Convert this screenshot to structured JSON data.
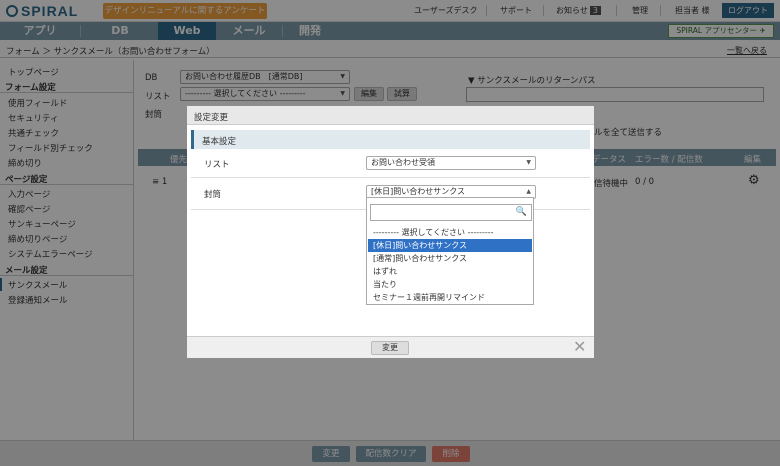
{
  "topbar": {
    "logo": "SPIRAL",
    "survey_button": "デザインリニューアルに関するアンケート",
    "links": [
      "ユーザーズデスク",
      "サポート",
      "お知らせ",
      "管理",
      "担当者 様"
    ],
    "notice_count": "3",
    "logout": "ログアウト"
  },
  "nav": {
    "tabs": [
      "アプリ",
      "DB",
      "Web",
      "メール",
      "開発"
    ],
    "active": "Web",
    "app_center": "SPIRAL アプリセンター"
  },
  "breadcrumb": "フォーム ＞ サンクスメール（お問い合わせフォーム）",
  "back_link": "一覧へ戻る",
  "sidebar": {
    "top": "トップページ",
    "form_heading": "フォーム設定",
    "form_items": [
      "使用フィールド",
      "セキュリティ",
      "共通チェック",
      "フィールド別チェック",
      "締め切り"
    ],
    "page_heading": "ページ設定",
    "page_items": [
      "入力ページ",
      "確認ページ",
      "サンキューページ",
      "締め切りページ",
      "システムエラーページ"
    ],
    "mail_heading": "メール設定",
    "mail_items": [
      "サンクスメール",
      "登録通知メール"
    ]
  },
  "main": {
    "db_label": "DB",
    "db_value": "お問い合わせ履歴DB　[通常DB]",
    "list_label": "リスト",
    "list_value": "--------- 選択してください ---------",
    "edit_btn": "編集",
    "test_btn": "試算",
    "envelope_label": "封筒",
    "return_path": "▼ サンクスメールのリターンパス",
    "send_all": "ルを全て送信する",
    "table_headers": [
      "優先",
      "データス",
      "エラー数 / 配信数",
      "編集"
    ],
    "row": {
      "index": "≡  1",
      "status": "信待機中",
      "count": "0 / 0"
    }
  },
  "bottom": {
    "change": "変更",
    "clear": "配信数クリア",
    "delete": "削除"
  },
  "modal": {
    "title": "設定変更",
    "section": "基本設定",
    "list_label": "リスト",
    "list_value": "お問い合わせ受領",
    "envelope_label": "封筒",
    "envelope_value": "[休日]問い合わせサンクス",
    "change_btn": "変更",
    "close": "✕",
    "options": [
      "--------- 選択してください ---------",
      "[休日]問い合わせサンクス",
      "[通常]問い合わせサンクス",
      "はずれ",
      "当たり",
      "セミナー１週前再開リマインド"
    ],
    "selected_index": 1
  },
  "colors": {
    "brand": "#2f6a8c",
    "survey": "#f0a040",
    "selected": "#2f71c5",
    "delete": "#e07a6a"
  }
}
